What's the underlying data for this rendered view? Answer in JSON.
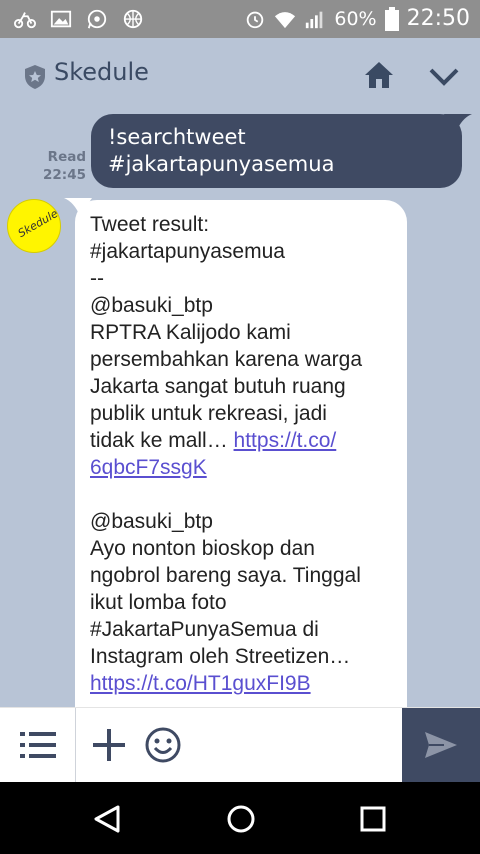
{
  "status_bar": {
    "battery_percent": "60%",
    "time": "22:50",
    "left_icons": [
      "bike-icon",
      "image-icon",
      "whatsapp-icon",
      "globe-icon"
    ],
    "right_icons": [
      "alarm-icon",
      "wifi-icon",
      "signal-icon",
      "battery-icon"
    ]
  },
  "app_bar": {
    "title": "Skedule"
  },
  "messages": {
    "outgoing": {
      "status": "Read",
      "time": "22:45",
      "lines": [
        "!searchtweet",
        "#jakartapunyasemua"
      ]
    },
    "incoming": {
      "avatar_label": "Skedule",
      "line1": "Tweet result:",
      "line2": "#jakartapunyasemua",
      "line3": "--",
      "line4": "@basuki_btp",
      "line5": "RPTRA Kalijodo kami",
      "line6": "persembahkan karena warga",
      "line7": "Jakarta sangat butuh ruang",
      "line8": "publik untuk rekreasi, jadi",
      "line9_text": "tidak ke mall… ",
      "line9_link": "https://t.co/",
      "line10_link": "6qbcF7ssgK",
      "line12": "@basuki_btp",
      "line13": "Ayo nonton bioskop dan",
      "line14": "ngobrol bareng saya. Tinggal",
      "line15": "ikut lomba foto",
      "line16": "#JakartaPunyaSemua di",
      "line17": "Instagram oleh Streetizen…",
      "line18_link": "https://t.co/HT1guxFI9B"
    }
  },
  "colors": {
    "chat_background": "#b8c4d6",
    "outgoing_bubble": "#3f4a63",
    "incoming_bubble": "#ffffff",
    "link": "#5a4fd0",
    "send_button": "#3f4a63"
  }
}
